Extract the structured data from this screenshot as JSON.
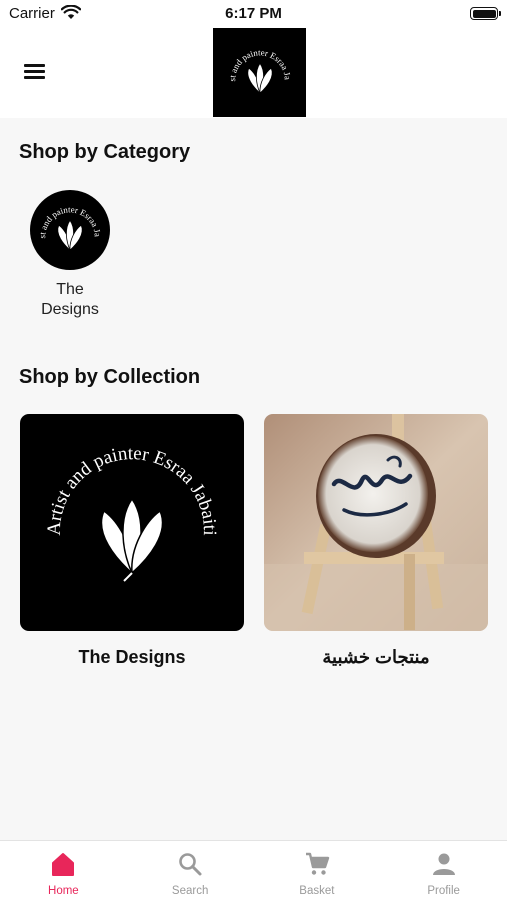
{
  "status_bar": {
    "carrier": "Carrier",
    "time": "6:17 PM"
  },
  "header": {
    "logo_alt": "Artist and painter Esraa Jabaiti logo"
  },
  "categories": {
    "title": "Shop by Category",
    "items": [
      {
        "label_line1": "The",
        "label_line2": "Designs"
      }
    ]
  },
  "collections": {
    "title": "Shop by Collection",
    "items": [
      {
        "label": "The Designs"
      },
      {
        "label": "منتجات خشبية"
      }
    ]
  },
  "logo_text": "Artist and painter Esraa Jabaiti",
  "tab_bar": {
    "tabs": [
      {
        "label": "Home",
        "icon": "home-icon",
        "active": true
      },
      {
        "label": "Search",
        "icon": "search-icon",
        "active": false
      },
      {
        "label": "Basket",
        "icon": "cart-icon",
        "active": false
      },
      {
        "label": "Profile",
        "icon": "person-icon",
        "active": false
      }
    ]
  },
  "colors": {
    "accent": "#e8265a",
    "inactive": "#9a9a9a"
  }
}
